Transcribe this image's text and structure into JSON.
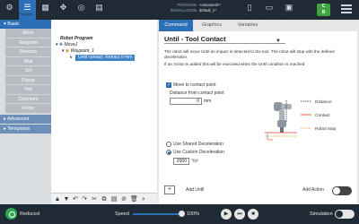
{
  "topbar": {
    "buttons": [
      {
        "label": "Run",
        "icon": "ur-logo-icon"
      },
      {
        "label": "Program",
        "icon": "program-icon"
      },
      {
        "label": "Installation",
        "icon": "installation-icon"
      },
      {
        "label": "Move",
        "icon": "move-icon"
      },
      {
        "label": "I/O",
        "icon": "io-icon"
      },
      {
        "label": "Log",
        "icon": "log-icon"
      }
    ],
    "active_button": "Program",
    "program_key": "PROGRAM",
    "program_value": "<unnamed>*",
    "installation_key": "INSTALLATION",
    "installation_value": "default_1*",
    "file_buttons": [
      {
        "label": "New...",
        "icon": "new-file-icon"
      },
      {
        "label": "Open...",
        "icon": "open-file-icon"
      },
      {
        "label": "Save...",
        "icon": "save-file-icon"
      }
    ],
    "badge_top": "C",
    "badge_bottom": "B"
  },
  "leftnav": {
    "basic_label": "Basic",
    "items": [
      "Move",
      "Waypoint",
      "Direction",
      "Wait",
      "Set",
      "Popup",
      "Halt",
      "Comment",
      "Folder"
    ],
    "advanced_label": "Advanced",
    "templates_label": "Templates"
  },
  "tree": {
    "root": "Robot Program",
    "movej": "MoveJ",
    "waypoint": "Waypoint_1",
    "until": "Until contact: Retract 0 mm"
  },
  "tabs": {
    "command": "Command",
    "graphics": "Graphics",
    "variables": "Variables"
  },
  "panel": {
    "title": "Until - Tool Contact",
    "desc1": "The robot will move Until an impact is detected to the tool. The robot will stop with the defined deceleration.",
    "desc2": "If an Action is added this will be executed when the Until condition is reached",
    "move_to_contact_label": "Move to contact point",
    "move_to_contact_checked": true,
    "distance_label": "Distance from contact point",
    "distance_value": "0",
    "distance_unit": "mm",
    "shared_decel_label": "Use Shared Deceleration",
    "custom_decel_label": "Use Custom Deceleration",
    "decel_value": "2000",
    "decel_unit": "°/s²",
    "legend_distance": "Distance",
    "legend_contact": "Contact",
    "legend_robot_stop": "Robot stop",
    "add_until_label": "Add Until",
    "add_action_label": "Add Action",
    "colors": {
      "distance": "#1f2a35",
      "contact": "#e0392b",
      "robot_stop": "#e8a23a"
    }
  },
  "bottombar": {
    "status": "Reduced",
    "speed_label": "Speed",
    "speed_value": "100%",
    "speed_fraction": 1.0,
    "simulation_label": "Simulation"
  }
}
